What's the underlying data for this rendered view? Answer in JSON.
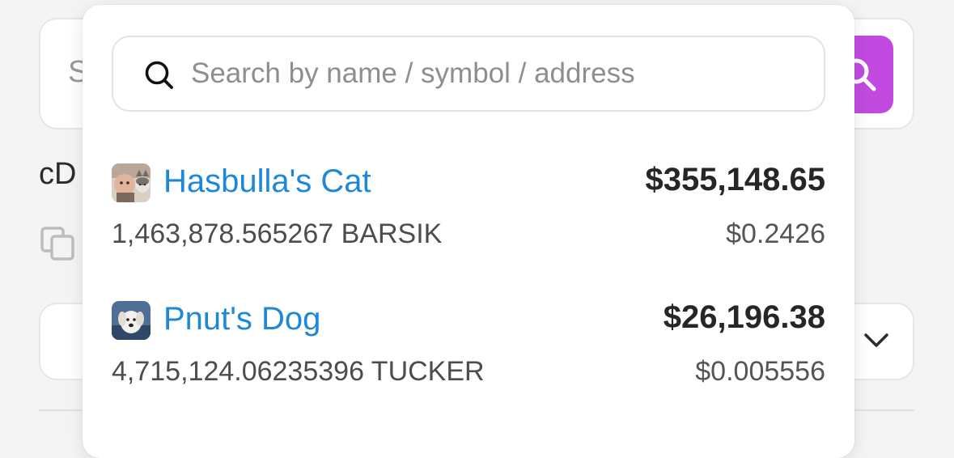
{
  "background": {
    "search_partial_text": "S",
    "wallet_partial_label": "cD",
    "accent_color": "#c24ae0",
    "icons": [
      "search-icon",
      "copy-icon",
      "chevron-down-icon"
    ]
  },
  "dropdown": {
    "search": {
      "placeholder": "Search by name / symbol / address",
      "value": ""
    },
    "tokens": [
      {
        "name": "Hasbulla's Cat",
        "value_usd": "$355,148.65",
        "amount": "1,463,878.565267 BARSIK",
        "price": "$0.2426",
        "logo_icon": "hasbulla-cat-logo"
      },
      {
        "name": "Pnut's Dog",
        "value_usd": "$26,196.38",
        "amount": "4,715,124.06235396 TUCKER",
        "price": "$0.005556",
        "logo_icon": "pnut-dog-logo"
      }
    ]
  },
  "colors": {
    "token_name": "#1e88d8",
    "accent": "#c24ae0"
  }
}
